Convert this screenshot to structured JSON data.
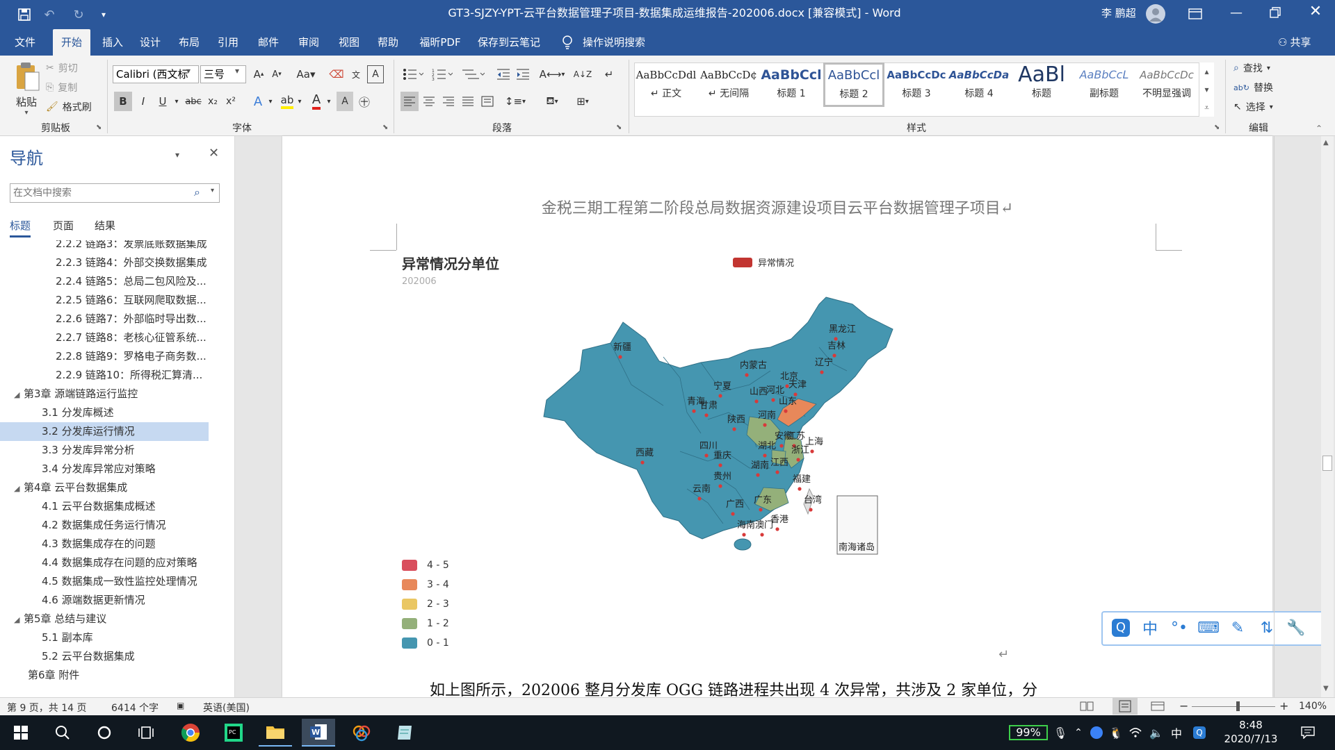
{
  "window": {
    "title": "GT3-SJZY-YPT-云平台数据管理子项目-数据集成运维报告-202006.docx [兼容模式]  -  Word",
    "user": "李 鹏超"
  },
  "tabs": [
    "文件",
    "开始",
    "插入",
    "设计",
    "布局",
    "引用",
    "邮件",
    "审阅",
    "视图",
    "帮助",
    "福昕PDF",
    "保存到云笔记"
  ],
  "active_tab": "开始",
  "tell_me": "操作说明搜索",
  "share": "共享",
  "ribbon": {
    "clipboard": {
      "paste": "粘贴",
      "cut": "剪切",
      "copy": "复制",
      "format_painter": "格式刷",
      "label": "剪贴板"
    },
    "font": {
      "name": "Calibri (西文标",
      "size": "三号",
      "label": "字体",
      "aa": "Aa"
    },
    "paragraph": {
      "label": "段落"
    },
    "styles": {
      "label": "样式",
      "items": [
        {
          "sample": "AaBbCcDdl",
          "name": "↵ 正文"
        },
        {
          "sample": "AaBbCcD¢",
          "name": "↵ 无间隔"
        },
        {
          "sample": "AaBbCcl",
          "name": "标题 1"
        },
        {
          "sample": "AaBbCcl",
          "name": "标题 2"
        },
        {
          "sample": "AaBbCcDc",
          "name": "标题 3"
        },
        {
          "sample": "AaBbCcDa",
          "name": "标题 4"
        },
        {
          "sample": "AaBl",
          "name": "标题"
        },
        {
          "sample": "AaBbCcL",
          "name": "副标题"
        },
        {
          "sample": "AaBbCcDc",
          "name": "不明显强调"
        }
      ]
    },
    "editing": {
      "find": "查找",
      "replace": "替换",
      "select": "选择",
      "label": "编辑"
    }
  },
  "navigation": {
    "title": "导航",
    "search_placeholder": "在文档中搜索",
    "tabs": [
      "标题",
      "页面",
      "结果"
    ],
    "items": [
      {
        "text": "2.2.2 链路3：发票底账数据集成",
        "level": 3
      },
      {
        "text": "2.2.3 链路4：外部交换数据集成",
        "level": 3
      },
      {
        "text": "2.2.4 链路5：总局二包风险及...",
        "level": 3
      },
      {
        "text": "2.2.5 链路6：互联网爬取数据...",
        "level": 3
      },
      {
        "text": "2.2.6 链路7：外部临时导出数...",
        "level": 3
      },
      {
        "text": "2.2.7 链路8：老核心征管系统...",
        "level": 3
      },
      {
        "text": "2.2.8 链路9：罗格电子商务数...",
        "level": 3
      },
      {
        "text": "2.2.9 链路10：所得税汇算清...",
        "level": 3
      },
      {
        "text": "第3章 源端链路运行监控",
        "level": 1
      },
      {
        "text": "3.1 分发库概述",
        "level": 2
      },
      {
        "text": "3.2 分发库运行情况",
        "level": 2
      },
      {
        "text": "3.3 分发库异常分析",
        "level": 2
      },
      {
        "text": "3.4 分发库异常应对策略",
        "level": 2
      },
      {
        "text": "第4章 云平台数据集成",
        "level": 1
      },
      {
        "text": "4.1 云平台数据集成概述",
        "level": 2
      },
      {
        "text": "4.2 数据集成任务运行情况",
        "level": 2
      },
      {
        "text": "4.3 数据集成存在的问题",
        "level": 2
      },
      {
        "text": "4.4 数据集成存在问题的应对策略",
        "level": 2
      },
      {
        "text": "4.5 数据集成一致性监控处理情况",
        "level": 2
      },
      {
        "text": "4.6 源端数据更新情况",
        "level": 2
      },
      {
        "text": "第5章 总结与建议",
        "level": 1
      },
      {
        "text": "5.1 副本库",
        "level": 2
      },
      {
        "text": "5.2 云平台数据集成",
        "level": 2
      },
      {
        "text": "第6章 附件",
        "level": 1
      }
    ]
  },
  "document": {
    "header": "金税三期工程第二阶段总局数据资源建设项目云平台数据管理子项目↵",
    "body_text": "如上图所示，202006 整月分发库 OGG 链路进程共出现 4 次异常，共涉及 2 家单位，分"
  },
  "chart_data": {
    "type": "map",
    "title": "异常情况分单位",
    "subtitle": "202006",
    "legend_series": "异常情况",
    "scale": [
      {
        "range": "4 - 5",
        "color": "#d94e5d"
      },
      {
        "range": "3 - 4",
        "color": "#e8885a"
      },
      {
        "range": "2 - 3",
        "color": "#eac763"
      },
      {
        "range": "1 - 2",
        "color": "#94b07a"
      },
      {
        "range": "0 - 1",
        "color": "#4596b0"
      }
    ],
    "regions": [
      {
        "name": "黑龙江"
      },
      {
        "name": "吉林"
      },
      {
        "name": "辽宁"
      },
      {
        "name": "新疆"
      },
      {
        "name": "内蒙古"
      },
      {
        "name": "北京"
      },
      {
        "name": "天津"
      },
      {
        "name": "宁夏"
      },
      {
        "name": "山西"
      },
      {
        "name": "河北"
      },
      {
        "name": "青海"
      },
      {
        "name": "甘肃"
      },
      {
        "name": "山东"
      },
      {
        "name": "陕西"
      },
      {
        "name": "河南"
      },
      {
        "name": "安徽"
      },
      {
        "name": "江苏"
      },
      {
        "name": "西藏"
      },
      {
        "name": "四川"
      },
      {
        "name": "湖北"
      },
      {
        "name": "上海"
      },
      {
        "name": "浙江"
      },
      {
        "name": "重庆"
      },
      {
        "name": "湖南"
      },
      {
        "name": "江西"
      },
      {
        "name": "贵州"
      },
      {
        "name": "福建"
      },
      {
        "name": "云南"
      },
      {
        "name": "广东"
      },
      {
        "name": "台湾"
      },
      {
        "name": "广西"
      },
      {
        "name": "香港"
      },
      {
        "name": "澳门"
      },
      {
        "name": "海南"
      }
    ],
    "inset_label": "南海诸岛"
  },
  "status": {
    "page": "第 9 页，共 14 页",
    "words": "6414 个字",
    "lang": "英语(美国)",
    "zoom": "140%"
  },
  "taskbar": {
    "battery": "99%",
    "time": "8:48",
    "date": "2020/7/13",
    "ime": "中"
  },
  "ime_bar": {
    "mode": "中"
  }
}
